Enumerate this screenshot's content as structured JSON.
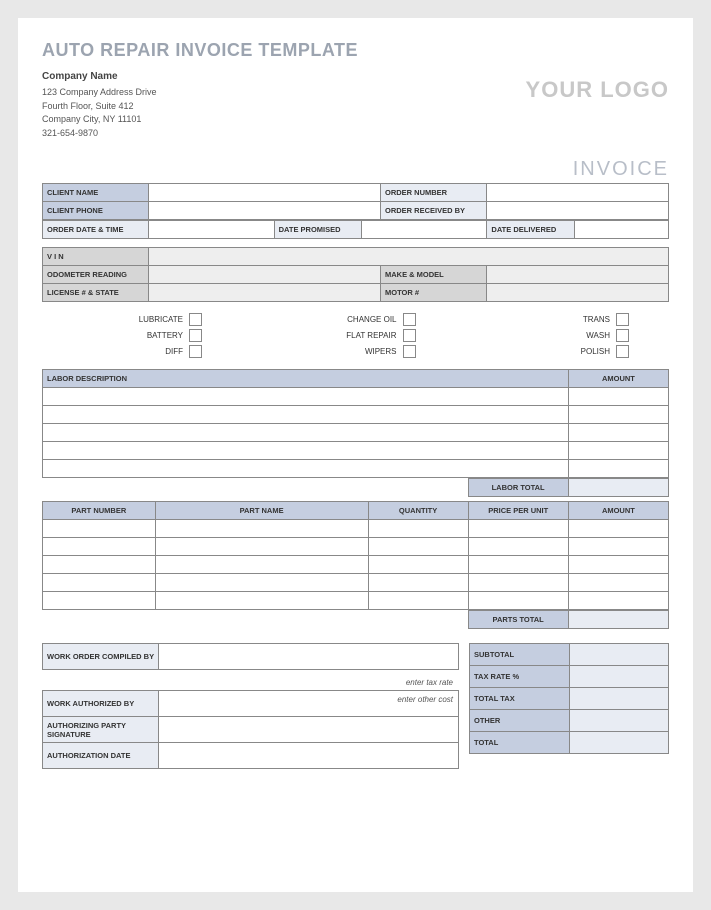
{
  "title": "AUTO REPAIR INVOICE TEMPLATE",
  "company": {
    "name": "Company Name",
    "address1": "123 Company Address Drive",
    "address2": "Fourth Floor, Suite 412",
    "city_line": "Company City, NY  11101",
    "phone": "321-654-9870"
  },
  "logo": "YOUR LOGO",
  "invoice_label": "INVOICE",
  "order_info": {
    "client_name_label": "CLIENT NAME",
    "order_number_label": "ORDER NUMBER",
    "client_phone_label": "CLIENT PHONE",
    "order_received_by_label": "ORDER RECEIVED BY",
    "order_date_time_label": "ORDER DATE & TIME",
    "date_promised_label": "DATE PROMISED",
    "date_delivered_label": "DATE DELIVERED"
  },
  "vehicle": {
    "vin_label": "V I N",
    "odometer_label": "ODOMETER READING",
    "make_model_label": "MAKE & MODEL",
    "license_label": "LICENSE # & STATE",
    "motor_label": "MOTOR #"
  },
  "services": {
    "lubricate": "LUBRICATE",
    "change_oil": "CHANGE OIL",
    "trans": "TRANS",
    "battery": "BATTERY",
    "flat_repair": "FLAT REPAIR",
    "wash": "WASH",
    "diff": "DIFF",
    "wipers": "WIPERS",
    "polish": "POLISH"
  },
  "labor": {
    "desc_label": "LABOR DESCRIPTION",
    "amount_label": "AMOUNT",
    "total_label": "LABOR TOTAL"
  },
  "parts": {
    "number_label": "PART NUMBER",
    "name_label": "PART NAME",
    "qty_label": "QUANTITY",
    "price_label": "PRICE PER UNIT",
    "amount_label": "AMOUNT",
    "total_label": "PARTS TOTAL"
  },
  "work_order": {
    "compiled_by_label": "WORK ORDER COMPILED BY",
    "authorized_by_label": "WORK AUTHORIZED BY",
    "signature_label": "AUTHORIZING PARTY SIGNATURE",
    "date_label": "AUTHORIZATION DATE"
  },
  "hints": {
    "tax_rate": "enter tax rate",
    "other_cost": "enter other cost"
  },
  "totals": {
    "subtotal_label": "SUBTOTAL",
    "tax_rate_label": "TAX RATE %",
    "total_tax_label": "TOTAL TAX",
    "other_label": "OTHER",
    "total_label": "TOTAL"
  }
}
